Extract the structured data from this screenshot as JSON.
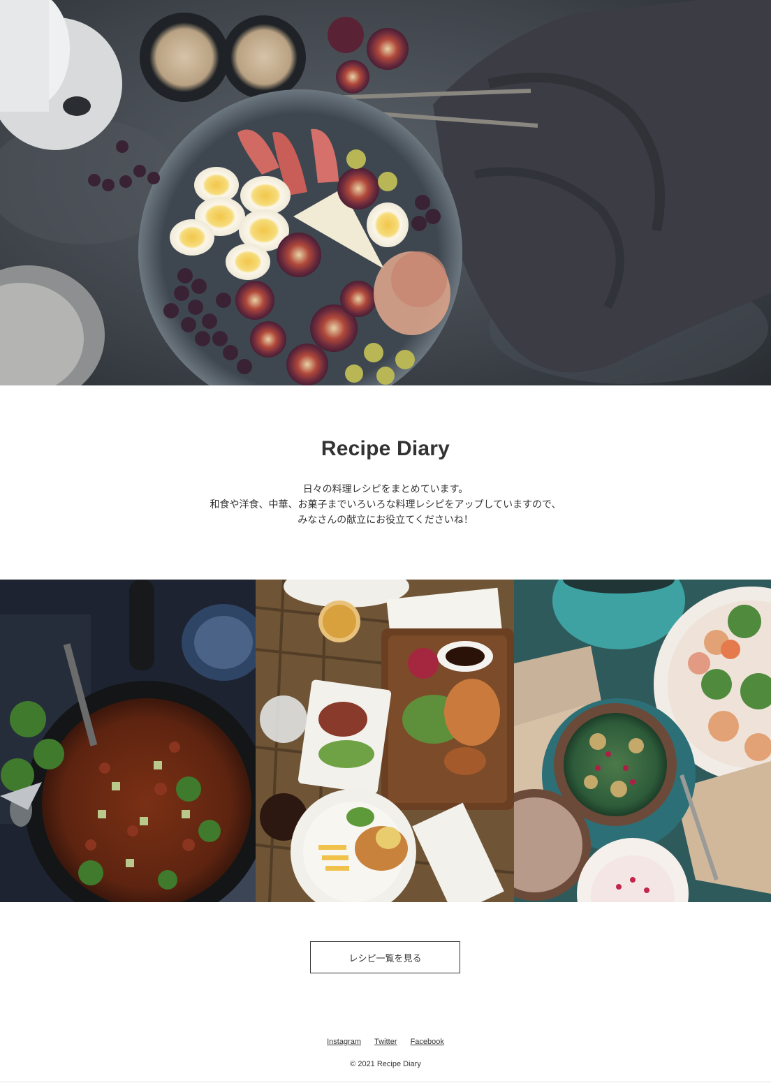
{
  "site": {
    "title": "Recipe Diary",
    "lead_lines": [
      "日々の料理レシピをまとめています。",
      "和食や洋食、中華、お菓子までいろいろな料理レシピをアップしていますので、",
      "みなさんの献立にお役立てくださいね！"
    ]
  },
  "button": {
    "label": "レシピ一覧を見る"
  },
  "footer": {
    "links": [
      "Instagram",
      "Twitter",
      "Facebook"
    ],
    "copyright": "© 2021 Recipe Diary"
  }
}
